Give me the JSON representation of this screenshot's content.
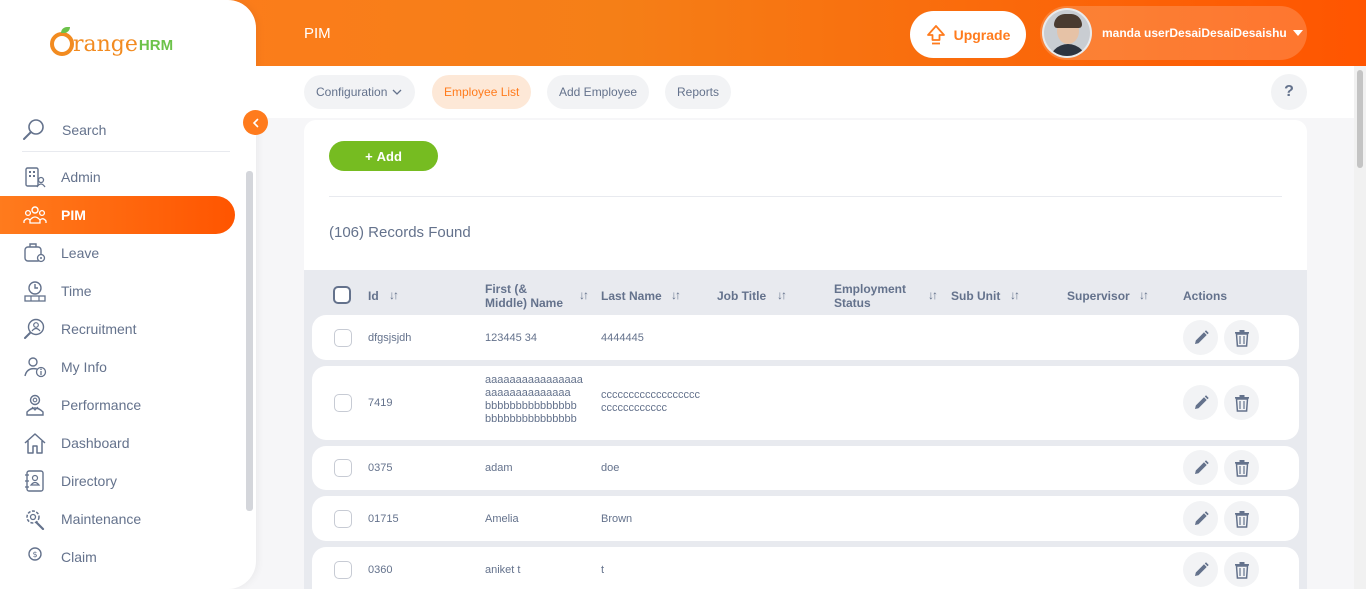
{
  "topbar": {
    "title": "PIM",
    "upgrade_label": "Upgrade",
    "user_name": "manda userDesaiDesaiDesaishu"
  },
  "brand": {
    "orange": "range",
    "hrm": "HRM"
  },
  "sidebar": {
    "search_label": "Search",
    "items": [
      {
        "label": "Admin",
        "icon": "admin-icon"
      },
      {
        "label": "PIM",
        "icon": "pim-icon",
        "active": true
      },
      {
        "label": "Leave",
        "icon": "leave-icon"
      },
      {
        "label": "Time",
        "icon": "time-icon"
      },
      {
        "label": "Recruitment",
        "icon": "recruitment-icon"
      },
      {
        "label": "My Info",
        "icon": "my-info-icon"
      },
      {
        "label": "Performance",
        "icon": "performance-icon"
      },
      {
        "label": "Dashboard",
        "icon": "dashboard-icon"
      },
      {
        "label": "Directory",
        "icon": "directory-icon"
      },
      {
        "label": "Maintenance",
        "icon": "maintenance-icon"
      },
      {
        "label": "Claim",
        "icon": "claim-icon"
      }
    ]
  },
  "subnav": {
    "tabs": [
      {
        "label": "Configuration"
      },
      {
        "label": "Employee List",
        "active": true
      },
      {
        "label": "Add Employee"
      },
      {
        "label": "Reports"
      }
    ],
    "help": "?"
  },
  "content": {
    "add_label": "Add",
    "records_found": "(106) Records Found"
  },
  "table": {
    "headers": {
      "id": "Id",
      "first_name_1": "First (&",
      "first_name_2": "Middle) Name",
      "last_name": "Last Name",
      "job_title": "Job Title",
      "employment_status_1": "Employment",
      "employment_status_2": "Status",
      "sub_unit": "Sub Unit",
      "supervisor": "Supervisor",
      "actions": "Actions"
    },
    "rows": [
      {
        "id": "dfgsjsjdh",
        "first": [
          "123445 34"
        ],
        "last": [
          "4444445"
        ]
      },
      {
        "id": "7419",
        "first": [
          "aaaaaaaaaaaaaaaa",
          "aaaaaaaaaaaaaa",
          "bbbbbbbbbbbbbbb",
          "bbbbbbbbbbbbbbb"
        ],
        "last": [
          "cccccccccccccccccc",
          "cccccccccccc"
        ]
      },
      {
        "id": "0375",
        "first": [
          "adam"
        ],
        "last": [
          "doe"
        ]
      },
      {
        "id": "01715",
        "first": [
          "Amelia"
        ],
        "last": [
          "Brown"
        ]
      },
      {
        "id": "0360",
        "first": [
          "aniket t"
        ],
        "last": [
          "t"
        ]
      }
    ]
  },
  "colors": {
    "brand_orange": "#ff7b1d",
    "add_green": "#76bc21",
    "text": "#64728c"
  }
}
